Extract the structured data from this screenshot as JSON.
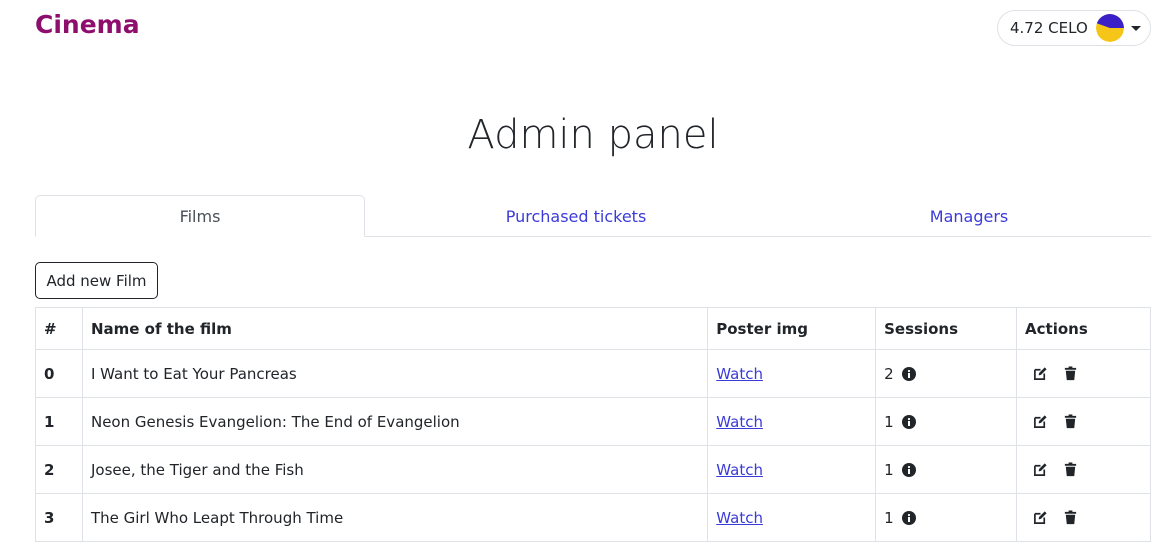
{
  "header": {
    "brand": "Cinema",
    "wallet_balance": "4.72 CELO"
  },
  "page": {
    "title": "Admin panel"
  },
  "tabs": [
    {
      "label": "Films",
      "active": true
    },
    {
      "label": "Purchased tickets",
      "active": false
    },
    {
      "label": "Managers",
      "active": false
    }
  ],
  "actions": {
    "add_film_label": "Add new Film"
  },
  "table": {
    "headers": [
      "#",
      "Name of the film",
      "Poster img",
      "Sessions",
      "Actions"
    ],
    "rows": [
      {
        "id": "0",
        "name": "I Want to Eat Your Pancreas",
        "poster": "Watch",
        "sessions": "2"
      },
      {
        "id": "1",
        "name": "Neon Genesis Evangelion: The End of Evangelion",
        "poster": "Watch",
        "sessions": "1"
      },
      {
        "id": "2",
        "name": "Josee, the Tiger and the Fish",
        "poster": "Watch",
        "sessions": "1"
      },
      {
        "id": "3",
        "name": "The Girl Who Leapt Through Time",
        "poster": "Watch",
        "sessions": "1"
      }
    ]
  },
  "icons": {
    "wallet_avatar": "identicon",
    "session_info": "info-circle-icon",
    "edit": "edit-icon",
    "delete": "trash-icon"
  },
  "colors": {
    "brand": "#8e0e6e",
    "link": "#3b3bd9",
    "avatar_primary": "#f5c518",
    "avatar_secondary": "#3b20c8"
  }
}
